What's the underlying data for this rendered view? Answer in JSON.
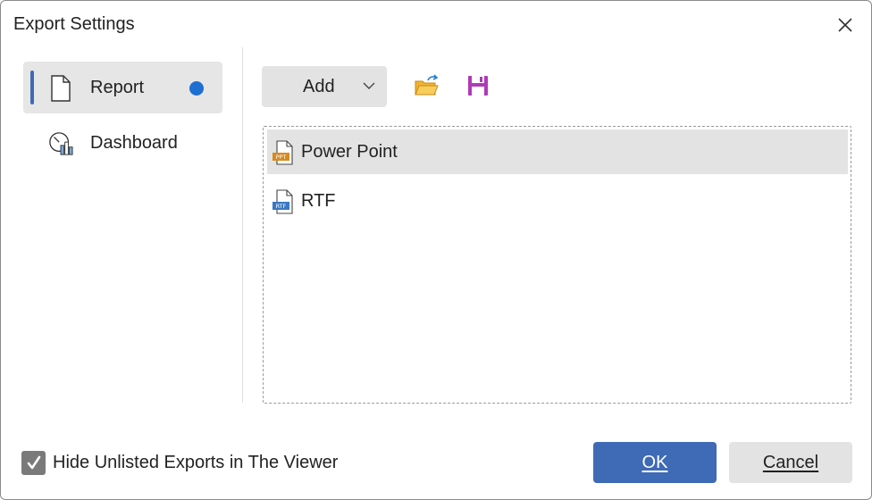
{
  "dialog": {
    "title": "Export Settings"
  },
  "nav": {
    "items": [
      {
        "label": "Report",
        "icon": "document-icon",
        "selected": true
      },
      {
        "label": "Dashboard",
        "icon": "dashboard-icon",
        "selected": false
      }
    ]
  },
  "toolbar": {
    "add_label": "Add",
    "open_icon": "folder-open-icon",
    "save_icon": "save-icon"
  },
  "exports": {
    "items": [
      {
        "label": "Power Point",
        "badge": "PPT",
        "badge_color": "#d88a1e",
        "selected": true
      },
      {
        "label": "RTF",
        "badge": "RTF",
        "badge_color": "#3b78c2",
        "selected": false
      }
    ]
  },
  "footer": {
    "hide_unlisted_label": "Hide Unlisted Exports in The Viewer",
    "hide_unlisted_checked": true,
    "ok_label": "OK",
    "cancel_label": "Cancel"
  },
  "colors": {
    "accent": "#3f6ab5",
    "selected_dot": "#1e6fd2",
    "save_icon": "#b03ab8",
    "folder_icon": "#f2b233"
  }
}
